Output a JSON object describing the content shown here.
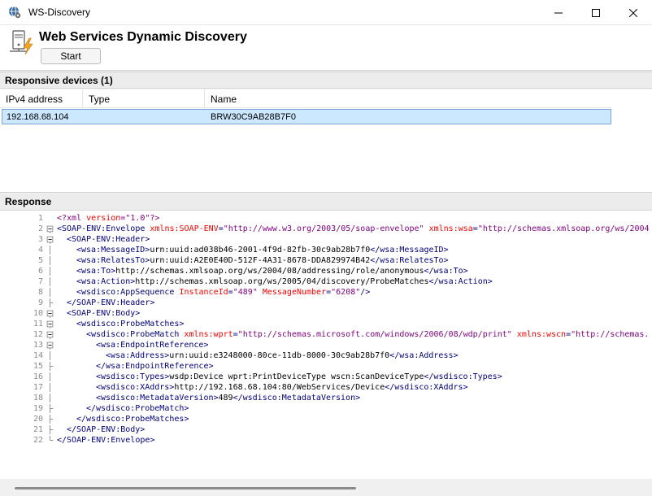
{
  "window": {
    "title": "WS-Discovery",
    "icon": "globe-gear-icon",
    "controls": [
      "minimize-icon",
      "maximize-icon",
      "close-icon"
    ]
  },
  "header": {
    "title": "Web Services Dynamic Discovery",
    "icon": "server-lightning-icon",
    "start_label": "Start"
  },
  "devices": {
    "section_title": "Responsive devices (1)",
    "columns": [
      "IPv4 address",
      "Type",
      "Name"
    ],
    "rows": [
      {
        "ip": "192.168.68.104",
        "type": "",
        "name": "BRW30C9AB28B7F0"
      }
    ]
  },
  "response": {
    "section_title": "Response",
    "lines": [
      {
        "n": "1",
        "fold": "",
        "indent": 0,
        "parts": [
          [
            "pi",
            "<?xml "
          ],
          [
            "attr",
            "version"
          ],
          [
            "pi",
            "=\"1.0\"?>"
          ]
        ]
      },
      {
        "n": "2",
        "fold": "box",
        "indent": 0,
        "parts": [
          [
            "tag",
            "<SOAP-ENV:Envelope "
          ],
          [
            "attr",
            "xmlns:SOAP-ENV"
          ],
          [
            "tag",
            "="
          ],
          [
            "str",
            "\"http://www.w3.org/2003/05/soap-envelope\""
          ],
          [
            "tag",
            " "
          ],
          [
            "attr",
            "xmlns:wsa"
          ],
          [
            "tag",
            "="
          ],
          [
            "str",
            "\"http://schemas.xmlsoap.org/ws/2004"
          ]
        ]
      },
      {
        "n": "3",
        "fold": "box",
        "indent": 1,
        "parts": [
          [
            "tag",
            "<SOAP-ENV:Header>"
          ]
        ]
      },
      {
        "n": "4",
        "fold": "line",
        "indent": 2,
        "parts": [
          [
            "tag",
            "<wsa:MessageID>"
          ],
          [
            "plain",
            "urn:uuid:ad038b46-2001-4f9d-82fb-30c9ab28b7f0"
          ],
          [
            "tag",
            "</wsa:MessageID>"
          ]
        ]
      },
      {
        "n": "5",
        "fold": "line",
        "indent": 2,
        "parts": [
          [
            "tag",
            "<wsa:RelatesTo>"
          ],
          [
            "plain",
            "urn:uuid:A2E0E40D-512F-4A31-8678-DDA829974B42"
          ],
          [
            "tag",
            "</wsa:RelatesTo>"
          ]
        ]
      },
      {
        "n": "6",
        "fold": "line",
        "indent": 2,
        "parts": [
          [
            "tag",
            "<wsa:To>"
          ],
          [
            "plain",
            "http://schemas.xmlsoap.org/ws/2004/08/addressing/role/anonymous"
          ],
          [
            "tag",
            "</wsa:To>"
          ]
        ]
      },
      {
        "n": "7",
        "fold": "line",
        "indent": 2,
        "parts": [
          [
            "tag",
            "<wsa:Action>"
          ],
          [
            "plain",
            "http://schemas.xmlsoap.org/ws/2005/04/discovery/ProbeMatches"
          ],
          [
            "tag",
            "</wsa:Action>"
          ]
        ]
      },
      {
        "n": "8",
        "fold": "line",
        "indent": 2,
        "parts": [
          [
            "tag",
            "<wsdisco:AppSequence "
          ],
          [
            "attr",
            "InstanceId"
          ],
          [
            "tag",
            "="
          ],
          [
            "str",
            "\"489\""
          ],
          [
            "tag",
            " "
          ],
          [
            "attr",
            "MessageNumber"
          ],
          [
            "tag",
            "="
          ],
          [
            "str",
            "\"6208\""
          ],
          [
            "tag",
            "/>"
          ]
        ]
      },
      {
        "n": "9",
        "fold": "end",
        "indent": 1,
        "parts": [
          [
            "tag",
            "</SOAP-ENV:Header>"
          ]
        ]
      },
      {
        "n": "10",
        "fold": "box",
        "indent": 1,
        "parts": [
          [
            "tag",
            "<SOAP-ENV:Body>"
          ]
        ]
      },
      {
        "n": "11",
        "fold": "box",
        "indent": 2,
        "parts": [
          [
            "tag",
            "<wsdisco:ProbeMatches>"
          ]
        ]
      },
      {
        "n": "12",
        "fold": "box",
        "indent": 3,
        "parts": [
          [
            "tag",
            "<wsdisco:ProbeMatch "
          ],
          [
            "attr",
            "xmlns:wprt"
          ],
          [
            "tag",
            "="
          ],
          [
            "str",
            "\"http://schemas.microsoft.com/windows/2006/08/wdp/print\""
          ],
          [
            "tag",
            " "
          ],
          [
            "attr",
            "xmlns:wscn"
          ],
          [
            "tag",
            "="
          ],
          [
            "str",
            "\"http://schemas."
          ]
        ]
      },
      {
        "n": "13",
        "fold": "box",
        "indent": 4,
        "parts": [
          [
            "tag",
            "<wsa:EndpointReference>"
          ]
        ]
      },
      {
        "n": "14",
        "fold": "line",
        "indent": 5,
        "parts": [
          [
            "tag",
            "<wsa:Address>"
          ],
          [
            "plain",
            "urn:uuid:e3248000-80ce-11db-8000-30c9ab28b7f0"
          ],
          [
            "tag",
            "</wsa:Address>"
          ]
        ]
      },
      {
        "n": "15",
        "fold": "end",
        "indent": 4,
        "parts": [
          [
            "tag",
            "</wsa:EndpointReference>"
          ]
        ]
      },
      {
        "n": "16",
        "fold": "line",
        "indent": 4,
        "parts": [
          [
            "tag",
            "<wsdisco:Types>"
          ],
          [
            "plain",
            "wsdp:Device wprt:PrintDeviceType wscn:ScanDeviceType"
          ],
          [
            "tag",
            "</wsdisco:Types>"
          ]
        ]
      },
      {
        "n": "17",
        "fold": "line",
        "indent": 4,
        "parts": [
          [
            "tag",
            "<wsdisco:XAddrs>"
          ],
          [
            "plain",
            "http://192.168.68.104:80/WebServices/Device"
          ],
          [
            "tag",
            "</wsdisco:XAddrs>"
          ]
        ]
      },
      {
        "n": "18",
        "fold": "line",
        "indent": 4,
        "parts": [
          [
            "tag",
            "<wsdisco:MetadataVersion>"
          ],
          [
            "plain",
            "489"
          ],
          [
            "tag",
            "</wsdisco:MetadataVersion>"
          ]
        ]
      },
      {
        "n": "19",
        "fold": "end",
        "indent": 3,
        "parts": [
          [
            "tag",
            "</wsdisco:ProbeMatch>"
          ]
        ]
      },
      {
        "n": "20",
        "fold": "end",
        "indent": 2,
        "parts": [
          [
            "tag",
            "</wsdisco:ProbeMatches>"
          ]
        ]
      },
      {
        "n": "21",
        "fold": "end",
        "indent": 1,
        "parts": [
          [
            "tag",
            "</SOAP-ENV:Body>"
          ]
        ]
      },
      {
        "n": "22",
        "fold": "last",
        "indent": 0,
        "parts": [
          [
            "tag",
            "</SOAP-ENV:Envelope>"
          ]
        ]
      }
    ]
  },
  "colors": {
    "tag": "#00007f",
    "attribute": "#ff0000",
    "string": "#7f007f",
    "selection": "#cce8ff"
  }
}
